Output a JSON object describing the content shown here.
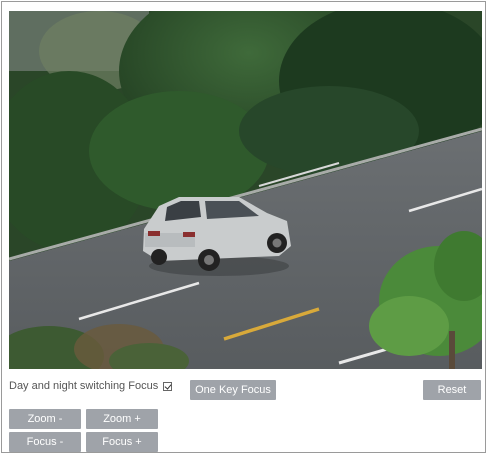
{
  "video": {
    "scene": "live-camera-feed"
  },
  "controls": {
    "day_night_label": "Day and night switching Focus",
    "day_night_checked": true,
    "one_key_focus_label": "One Key Focus",
    "reset_label": "Reset",
    "zoom_minus_label": "Zoom -",
    "zoom_plus_label": "Zoom +",
    "focus_minus_label": "Focus -",
    "focus_plus_label": "Focus +"
  },
  "colors": {
    "button_bg": "#9fa3a9",
    "button_text": "#ffffff",
    "label_text": "#555555",
    "border": "#9a9a9a"
  }
}
